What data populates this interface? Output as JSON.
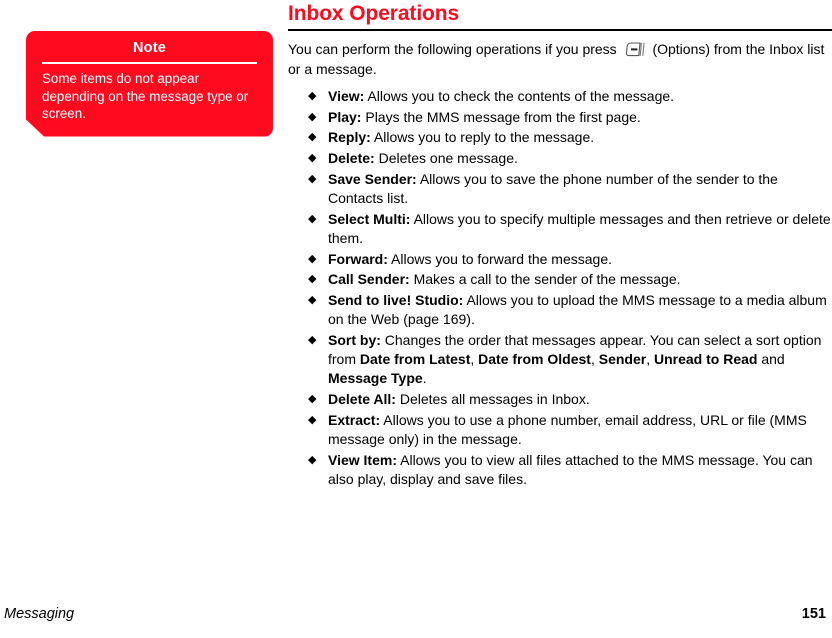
{
  "note": {
    "title": "Note",
    "body": "Some items do not appear depending on the message type or screen.",
    "bg_color": "#ff0a1e",
    "text_color": "#ffffff"
  },
  "header": {
    "title": "Inbox Operations",
    "title_color": "#ff0a1e",
    "rule_color": "#000000"
  },
  "intro": {
    "before_icon": "You can perform the following operations if you press",
    "icon_name": "soft-key-options-icon",
    "after_icon": "(Options) from the Inbox list or a message."
  },
  "operations": {
    "bullet_glyph": "◆",
    "items": [
      {
        "label": "View:",
        "text": " Allows you to check the contents of the message."
      },
      {
        "label": "Play:",
        "text": " Plays the MMS message from the first page."
      },
      {
        "label": "Reply:",
        "text": " Allows you to reply to the message."
      },
      {
        "label": "Delete:",
        "text": " Deletes one message."
      },
      {
        "label": "Save Sender:",
        "text": " Allows you to save the phone number of the sender to the Contacts list."
      },
      {
        "label": "Select Multi:",
        "text": " Allows you to specify multiple messages and then retrieve or delete them."
      },
      {
        "label": "Forward:",
        "text": " Allows you to forward the message."
      },
      {
        "label": "Call Sender:",
        "text": " Makes a call to the sender of the message."
      },
      {
        "label": "Send to live! Studio:",
        "text": " Allows you to upload the MMS message to a media album on the Web (page 169)."
      },
      {
        "label": "Sort by:",
        "text_1": " Changes the order that messages appear. You can select a sort option from ",
        "bold_1": "Date from Latest",
        "sep_1": ", ",
        "bold_2": "Date from Oldest",
        "sep_2": ", ",
        "bold_3": "Sender",
        "sep_3": ", ",
        "bold_4": "Unread to Read",
        "sep_4": " and ",
        "bold_5": "Message Type",
        "tail": "."
      },
      {
        "label": "Delete All:",
        "text": " Deletes all messages in Inbox."
      },
      {
        "label": "Extract:",
        "text": " Allows you to use a phone number, email address, URL or file (MMS message only) in the message."
      },
      {
        "label": "View Item:",
        "text": " Allows you to view all files attached to the MMS message. You can also play, display and save files."
      }
    ]
  },
  "footer": {
    "section": "Messaging",
    "page_number": "151"
  }
}
